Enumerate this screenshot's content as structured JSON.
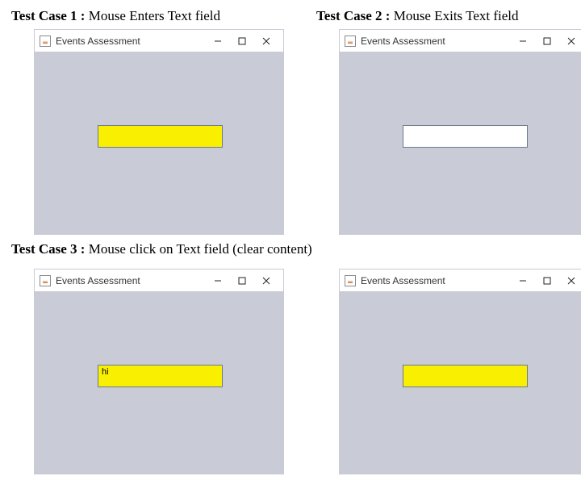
{
  "cases": {
    "c1": {
      "label_bold": "Test Case 1 :",
      "label_rest": " Mouse Enters Text field"
    },
    "c2": {
      "label_bold": "Test Case 2 :",
      "label_rest": " Mouse Exits Text field"
    },
    "c3": {
      "label_bold": "Test Case 3 :",
      "label_rest": " Mouse click on Text field (clear content)"
    }
  },
  "windows": {
    "w1": {
      "title": "Events Assessment",
      "textfield_value": "",
      "textfield_bg": "yellow"
    },
    "w2": {
      "title": "Events Assessment",
      "textfield_value": "",
      "textfield_bg": "white"
    },
    "w3": {
      "title": "Events Assessment",
      "textfield_value": "hi",
      "textfield_bg": "yellow"
    },
    "w4": {
      "title": "Events Assessment",
      "textfield_value": "",
      "textfield_bg": "yellow"
    }
  }
}
